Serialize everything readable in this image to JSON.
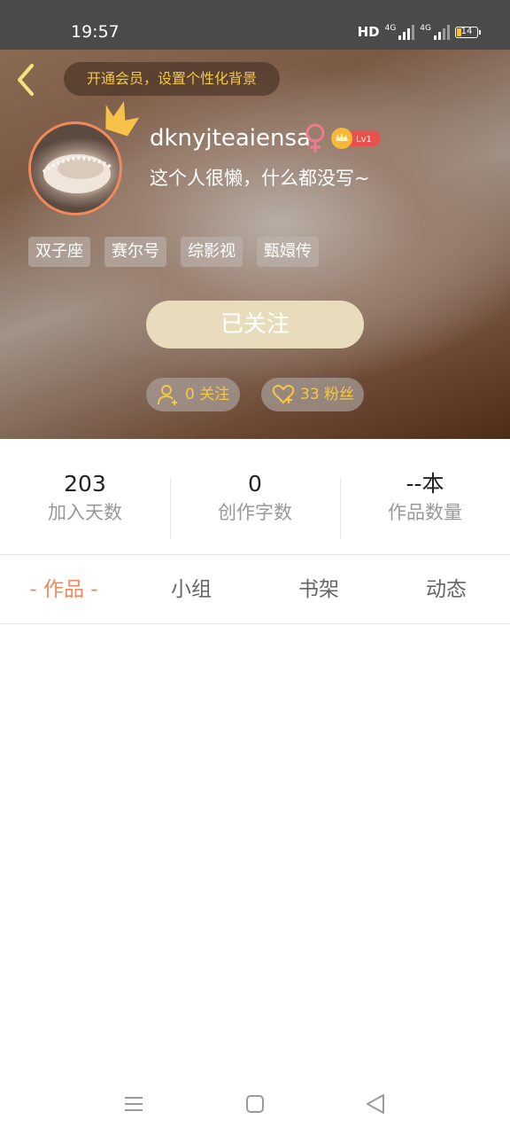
{
  "status_bar": {
    "time": "19:57",
    "hd": "HD",
    "network_1": "4G",
    "network_2": "4G",
    "battery": "14",
    "battery_color": "#f2c53d"
  },
  "header": {
    "back_icon": "chevron-left-icon",
    "vip_banner": "开通会员，设置个性化背景",
    "username": "dknyjteaiensa",
    "gender_icon": "female-icon",
    "level": "Lv1",
    "bio": "这个人很懒，什么都没写~",
    "tags": [
      "双子座",
      "赛尔号",
      "综影视",
      "甄嬛传"
    ],
    "follow_label": "已关注",
    "following_label": "0 关注",
    "fans_label": "33 粉丝",
    "accent_color": "#f5c842"
  },
  "stats": [
    {
      "value": "203",
      "label": "加入天数"
    },
    {
      "value": "0",
      "label": "创作字数"
    },
    {
      "value": "--本",
      "label": "作品数量"
    }
  ],
  "tabs": [
    {
      "label": "- 作品 -",
      "active": true
    },
    {
      "label": "小组",
      "active": false
    },
    {
      "label": "书架",
      "active": false
    },
    {
      "label": "动态",
      "active": false
    }
  ],
  "active_tab_color": "#f08a5d",
  "nav_bar": {
    "icons": [
      "menu-icon",
      "home-icon",
      "back-icon"
    ]
  }
}
